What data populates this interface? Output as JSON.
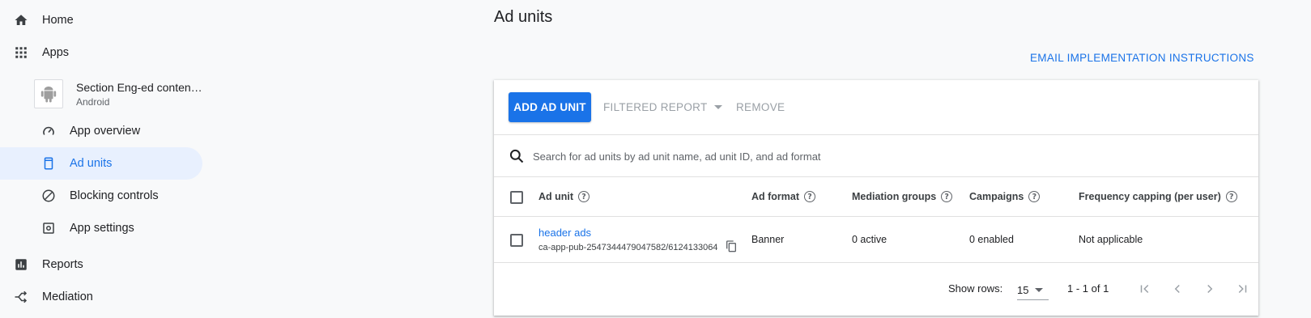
{
  "sidebar": {
    "home": "Home",
    "apps": "Apps",
    "app": {
      "name": "Section Eng-ed conten…",
      "platform": "Android"
    },
    "sub_items": {
      "overview": "App overview",
      "ad_units": "Ad units",
      "blocking": "Blocking controls",
      "settings": "App settings"
    },
    "reports": "Reports",
    "mediation": "Mediation"
  },
  "page": {
    "title": "Ad units",
    "email_link": "EMAIL IMPLEMENTATION INSTRUCTIONS"
  },
  "toolbar": {
    "add": "ADD AD UNIT",
    "filtered_report": "FILTERED REPORT",
    "remove": "REMOVE"
  },
  "search": {
    "placeholder": "Search for ad units by ad unit name, ad unit ID, and ad format"
  },
  "table": {
    "headers": {
      "ad_unit": "Ad unit",
      "ad_format": "Ad format",
      "mediation": "Mediation groups",
      "campaigns": "Campaigns",
      "frequency": "Frequency capping (per user)"
    },
    "rows": [
      {
        "name": "header ads",
        "id": "ca-app-pub-2547344479047582/6124133064",
        "format": "Banner",
        "mediation": "0 active",
        "campaigns": "0 enabled",
        "frequency": "Not applicable"
      }
    ]
  },
  "pagination": {
    "rows_label": "Show rows:",
    "rows_value": "15",
    "range": "1 - 1 of 1"
  },
  "colors": {
    "accent": "#1a73e8",
    "active_bg": "#e8f0fe"
  }
}
